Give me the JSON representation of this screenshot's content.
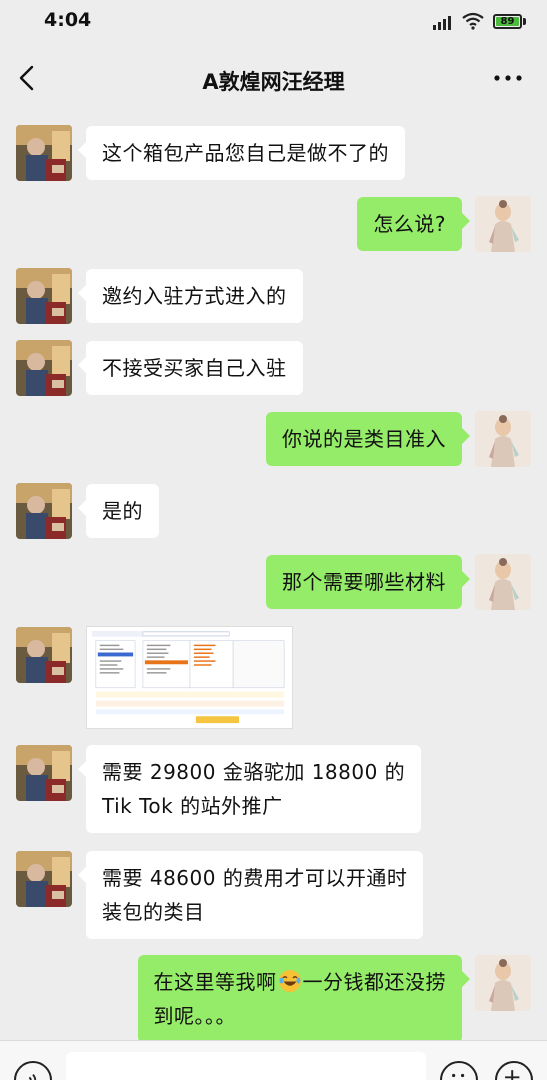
{
  "status_bar": {
    "time": "4:04",
    "battery": "89"
  },
  "header": {
    "title": "A敦煌网汪经理"
  },
  "messages": [
    {
      "side": "left",
      "text": "这个箱包产品您自己是做不了的"
    },
    {
      "side": "right",
      "text": "怎么说?"
    },
    {
      "side": "left",
      "text": "邀约入驻方式进入的"
    },
    {
      "side": "left",
      "text": "不接受买家自己入驻"
    },
    {
      "side": "right",
      "text": "你说的是类目准入"
    },
    {
      "side": "left",
      "text": "是的"
    },
    {
      "side": "right",
      "text": "那个需要哪些材料"
    },
    {
      "side": "left",
      "type": "image"
    },
    {
      "side": "left",
      "line1": "需要 29800 金骆驼加 18800 的",
      "line2": "Tik Tok 的站外推广"
    },
    {
      "side": "left",
      "line1": "需要 48600 的费用才可以开通时",
      "line2": "装包的类目"
    },
    {
      "side": "right",
      "line1_a": "在这里等我啊",
      "line1_b": "一分钱都还没捞",
      "line2": "到呢。。。"
    }
  ],
  "colors": {
    "background": "#ededed",
    "bubble_self": "#95ec69",
    "bubble_other": "#ffffff"
  },
  "icons": [
    "back-icon",
    "more-icon",
    "signal-icon",
    "wifi-icon",
    "battery-icon",
    "voice-icon",
    "emoji-icon",
    "plus-icon",
    "laughing-emoji-icon"
  ]
}
